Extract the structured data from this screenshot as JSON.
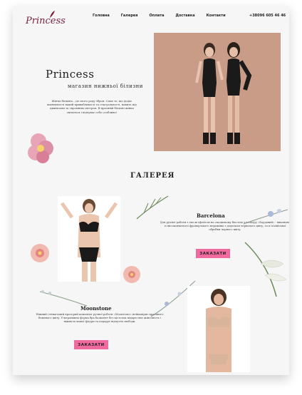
{
  "header": {
    "logo_text": "Princess",
    "nav": [
      "Головна",
      "Галерея",
      "Оплата",
      "Доставка",
      "Контакти"
    ],
    "phone": "+38096 605 46 46"
  },
  "hero": {
    "brand": "Princess",
    "tagline": "магазин нижньої білизни",
    "text": "Жінча білизна – це свого роду зброя. Саме те, що додає впевненості вашій привабливості та сексуальності, навить під джинсами та скромним светром. В красивій білизні жінка світиться і відчуває себе особливо!"
  },
  "gallery": {
    "title": "Галерея",
    "products": [
      {
        "name": "Barcelona",
        "description": "Для ручної роботи з еко-ж-ефектом на спадковому бюстові з кольору «Бордовий» - виконано із високоякісного французького мережива з додатком червоного цвіту, та в італійської обробки чорного цвіту.",
        "button": "Заказати"
      },
      {
        "name": "Moonstone",
        "description": "Ніжний і невагомий прозорий комплект ручної роботи «Moonstone» неймовірно красивого бежевого цвіту. Ультраніжна форма бра балконет без кісточок підкреслює жіночність і ніжність вашої фігури та подарує відчуття свободи.",
        "button": "Заказати"
      }
    ]
  },
  "colors": {
    "accent": "#f06aa0",
    "logo": "#7a1f3b",
    "hero_bg": "#c79b85"
  }
}
